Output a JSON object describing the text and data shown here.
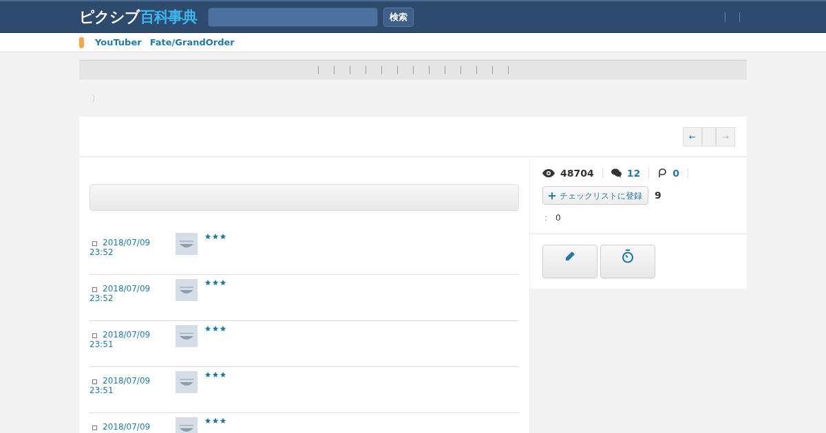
{
  "header": {
    "logo": {
      "kana": "ピクシブ",
      "kanji": "百科事典"
    },
    "search": {
      "button": "検索"
    }
  },
  "tags": [
    "YouTuber",
    "Fate/GrandOrder"
  ],
  "breadcrumb": {
    "separator": "〉"
  },
  "pager": {
    "prev": "←",
    "next": "→"
  },
  "stats": {
    "views": "48704",
    "comments": "12",
    "pins": "0"
  },
  "checklist": {
    "button": "チェックリストに登録",
    "count": "9"
  },
  "info": {
    "label": ":",
    "value": "0"
  },
  "comments": [
    {
      "datetime": "2018/07/09 23:52",
      "stars": 3
    },
    {
      "datetime": "2018/07/09 23:52",
      "stars": 3
    },
    {
      "datetime": "2018/07/09 23:51",
      "stars": 3
    },
    {
      "datetime": "2018/07/09 23:51",
      "stars": 3
    },
    {
      "datetime": "2018/07/09",
      "stars": 3
    }
  ]
}
